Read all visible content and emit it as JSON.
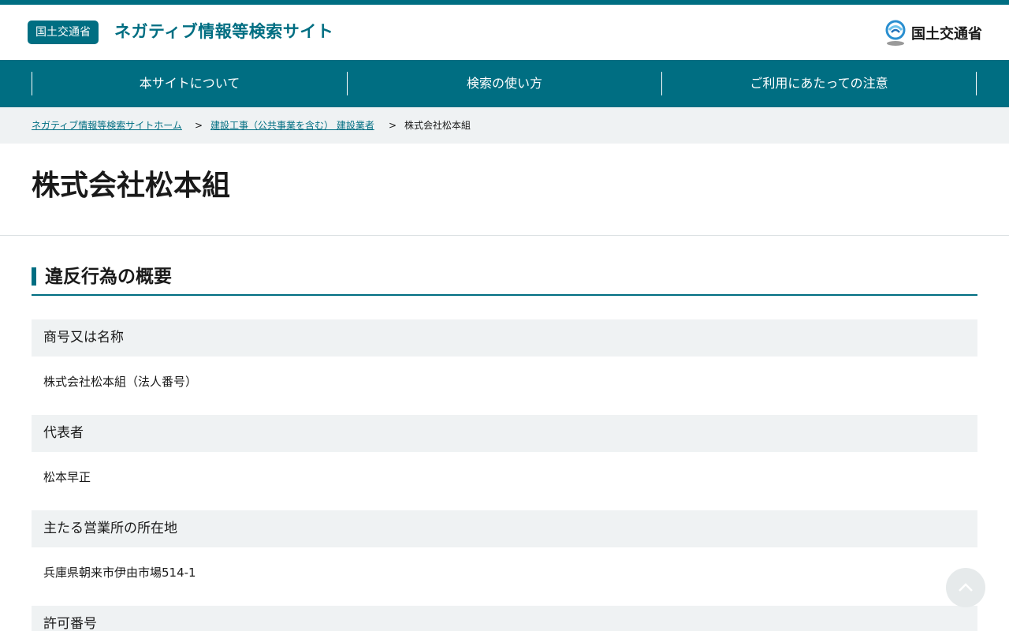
{
  "header": {
    "badge": "国土交通省",
    "site_title": "ネガティブ情報等検索サイト",
    "logo_text": "国土交通省"
  },
  "nav": {
    "items": [
      {
        "label": "本サイトについて"
      },
      {
        "label": "検索の使い方"
      },
      {
        "label": "ご利用にあたっての注意"
      }
    ]
  },
  "breadcrumb": {
    "home": "ネガティブ情報等検索サイトホーム",
    "category": "建設工事（公共事業を含む） 建設業者",
    "current": "株式会社松本組",
    "separator": ">"
  },
  "page": {
    "title": "株式会社松本組"
  },
  "section": {
    "heading": "違反行為の概要",
    "rows": [
      {
        "label": "商号又は名称",
        "value": "株式会社松本組（法人番号）"
      },
      {
        "label": "代表者",
        "value": "松本早正"
      },
      {
        "label": "主たる営業所の所在地",
        "value": "兵庫県朝来市伊由市場514-1"
      },
      {
        "label": "許可番号",
        "value": ""
      }
    ]
  },
  "colors": {
    "brand": "#006e82",
    "label_bg": "#eff2f3"
  },
  "icons": {
    "back_to_top": "chevron-up-icon",
    "logo": "ministry-logo-icon"
  }
}
